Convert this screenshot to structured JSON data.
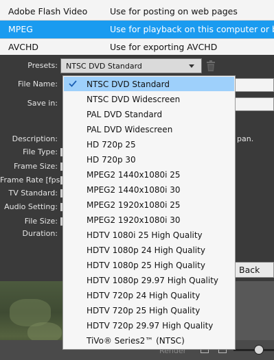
{
  "formats": [
    {
      "name": "Adobe Flash Video",
      "description": "Use for posting on web pages",
      "selected": false
    },
    {
      "name": "MPEG",
      "description": "Use for playback on this computer or burni",
      "selected": true
    },
    {
      "name": "AVCHD",
      "description": "Use for exporting AVCHD",
      "selected": false
    }
  ],
  "form": {
    "presets_label": "Presets:",
    "preset_value": "NTSC DVD Standard",
    "file_name_label": "File Name:",
    "save_in_label": "Save in:",
    "description_label": "Description:",
    "description_tail": "pan.",
    "file_type_label": "File Type:",
    "frame_size_label": "Frame Size:",
    "frame_rate_label": "Frame Rate [fps]:",
    "tv_standard_label": "TV Standard:",
    "audio_setting_label": "Audio Setting:",
    "file_size_label": "File Size:",
    "duration_label": "Duration:"
  },
  "preset_options": [
    "NTSC DVD Standard",
    "NTSC DVD Widescreen",
    "PAL DVD Standard",
    "PAL DVD Widescreen",
    "HD 720p 25",
    "HD 720p 30",
    "MPEG2 1440x1080i 25",
    "MPEG2 1440x1080i 30",
    "MPEG2 1920x1080i 25",
    "MPEG2 1920x1080i 30",
    "HDTV 1080i 25 High Quality",
    "HDTV 1080p 24 High Quality",
    "HDTV 1080p 25 High Quality",
    "HDTV 1080p 29.97 High Quality",
    "HDTV 720p 24 High Quality",
    "HDTV 720p 25 High Quality",
    "HDTV 720p 29.97 High Quality",
    "TiVo® Series2™ (NTSC)"
  ],
  "selected_option": "NTSC DVD Standard",
  "buttons": {
    "back": "Back"
  },
  "bottom_bar": {
    "render_label": "Render"
  },
  "colors": {
    "selection_blue": "#1a9bf0",
    "dropdown_highlight": "#9ed0fb",
    "panel_bg": "#3a3a3a"
  },
  "icons": [
    "trash-icon",
    "chevron-down-icon",
    "checkmark-icon"
  ]
}
